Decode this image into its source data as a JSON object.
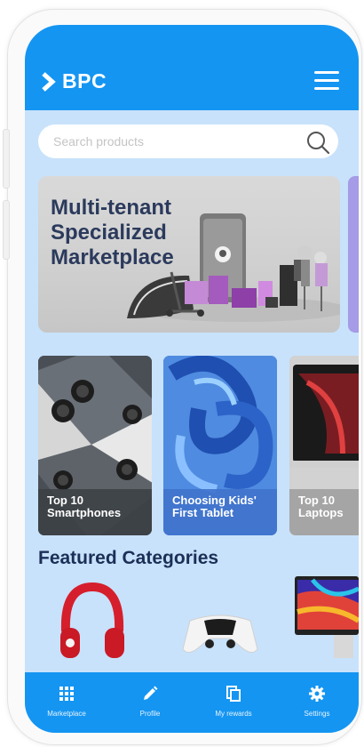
{
  "header": {
    "brand": "BPC"
  },
  "search": {
    "placeholder": "Search products"
  },
  "banner": {
    "title": "Multi-tenant Specialized Marketplace"
  },
  "cards": [
    {
      "label": "Top 10 Smartphones"
    },
    {
      "label": "Choosing Kids' First Tablet"
    },
    {
      "label": "Top 10 Laptops"
    }
  ],
  "featured": {
    "title": "Featured Categories"
  },
  "nav": [
    {
      "label": "Marketplace",
      "icon": "grid-icon"
    },
    {
      "label": "Profile",
      "icon": "pencil-icon"
    },
    {
      "label": "My rewards",
      "icon": "copy-icon"
    },
    {
      "label": "Settings",
      "icon": "gear-icon"
    }
  ],
  "colors": {
    "primary": "#1495f2",
    "background": "#c8e2fb",
    "heading": "#1c2f57"
  }
}
